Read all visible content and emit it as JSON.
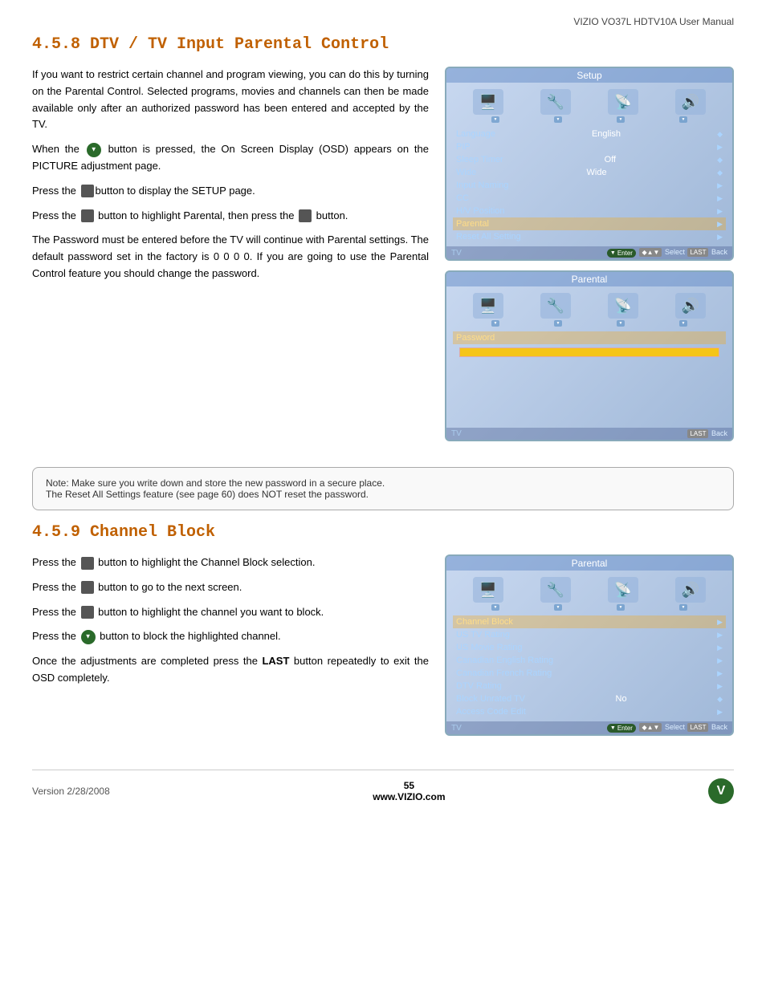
{
  "header": {
    "title": "VIZIO VO37L HDTV10A User Manual"
  },
  "section1": {
    "title": "4.5.8 DTV / TV Input Parental Control",
    "paragraphs": [
      "If you want to restrict certain channel and program viewing, you can do this by turning on the Parental Control.  Selected programs, movies and channels can then be made available only after an authorized password has been entered and accepted by the TV.",
      "When the [V] button is pressed, the On Screen Display (OSD) appears on the PICTURE adjustment page.",
      "Press the [btn] button to display the SETUP page.",
      "Press the [btn] button to highlight Parental, then press the [btn] button.",
      "The Password must be entered before the TV will continue with Parental settings.  The default password set in the factory is 0 0 0 0.  If you are going to use the Parental Control feature you should change the password."
    ]
  },
  "setup_screen": {
    "title": "Setup",
    "menu_items": [
      {
        "label": "Language",
        "value": "English",
        "arrow": "◆"
      },
      {
        "label": "PIP",
        "value": "",
        "arrow": "▶"
      },
      {
        "label": "Sleep Timer",
        "value": "Off",
        "arrow": "◆"
      },
      {
        "label": "Wide",
        "value": "Wide",
        "arrow": "◆"
      },
      {
        "label": "Input Naming",
        "value": "",
        "arrow": "▶"
      },
      {
        "label": "CC",
        "value": "",
        "arrow": "▶"
      },
      {
        "label": "H/V Position",
        "value": "",
        "arrow": "▶"
      },
      {
        "label": "Parental",
        "value": "",
        "arrow": "▶",
        "highlighted": true
      },
      {
        "label": "Reset All Setting",
        "value": "",
        "arrow": "▶"
      }
    ],
    "bottom_label": "TV",
    "bottom_controls": "Enter  Select  Back"
  },
  "parental_screen": {
    "title": "Parental",
    "menu_items": [
      {
        "label": "Password",
        "value": "",
        "has_field": true
      }
    ],
    "bottom_label": "TV",
    "bottom_controls": "Back"
  },
  "note": {
    "text": "Note: Make sure you write down and store the new password in a secure place.\nThe Reset All Settings feature (see page 60) does NOT reset the password."
  },
  "section2": {
    "title": "4.5.9 Channel Block",
    "paragraphs": [
      "Press the [btn] button to highlight the Channel Block selection.",
      "Press the [btn] button to go to the next screen.",
      "Press the [btn] button to highlight the channel you want to block.",
      "Press the [V] button to block the highlighted channel.",
      "Once the adjustments are completed press the LAST button repeatedly to exit the OSD completely."
    ]
  },
  "channel_block_screen": {
    "title": "Parental",
    "menu_items": [
      {
        "label": "Channel Block",
        "value": "",
        "arrow": "▶",
        "highlighted": true
      },
      {
        "label": "US TV Rating",
        "value": "",
        "arrow": "▶"
      },
      {
        "label": "US Movie Rating",
        "value": "",
        "arrow": "▶"
      },
      {
        "label": "Canadian English Rating",
        "value": "",
        "arrow": "▶"
      },
      {
        "label": "Canadian French Rating",
        "value": "",
        "arrow": "▶"
      },
      {
        "label": "DTV Rating",
        "value": "",
        "arrow": "▶"
      },
      {
        "label": "Block Unrated TV",
        "value": "No",
        "arrow": "◆"
      },
      {
        "label": "Access Code Edit",
        "value": "",
        "arrow": "▶"
      }
    ],
    "bottom_label": "TV",
    "bottom_controls": "Enter  Select  Back"
  },
  "footer": {
    "version": "Version 2/28/2008",
    "page": "55",
    "website": "www.VIZIO.com"
  }
}
